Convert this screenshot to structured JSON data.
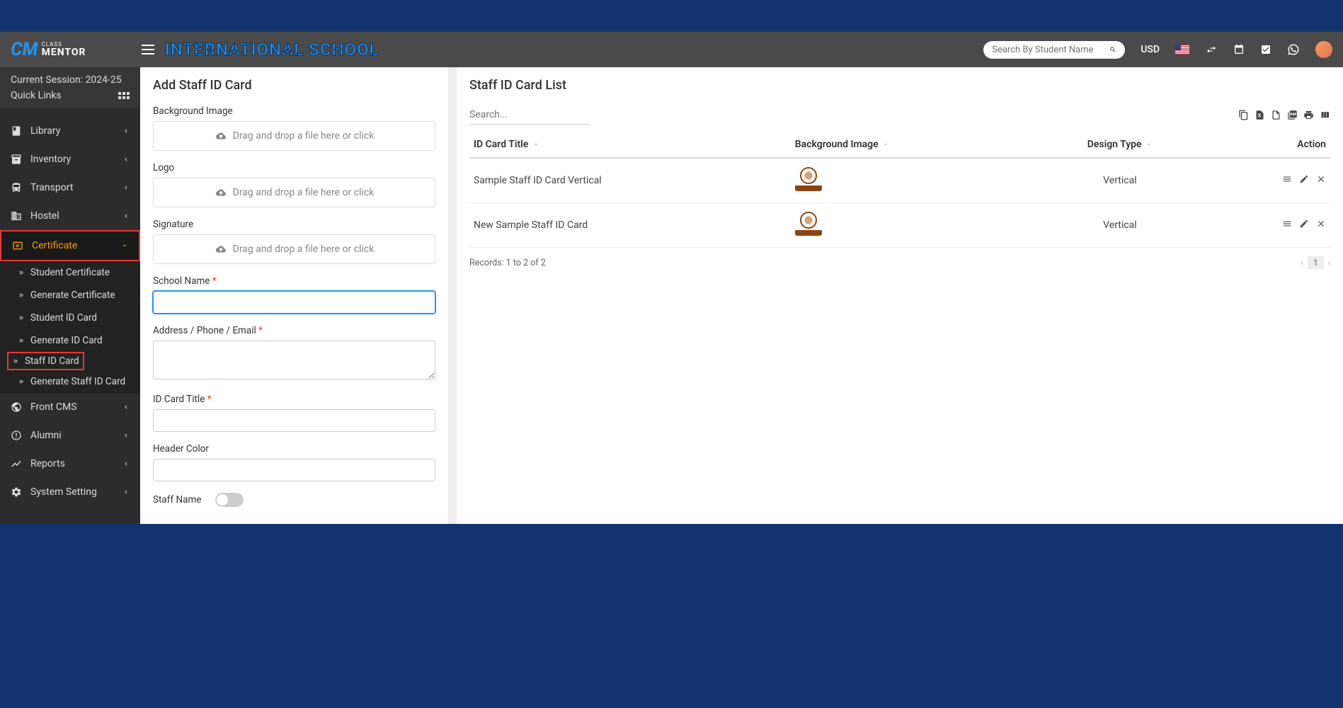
{
  "header": {
    "school_title": "INTERNATIONAL SCHOOL",
    "search_placeholder": "Search By Student Name",
    "currency": "USD"
  },
  "sidebar": {
    "session_text": "Current Session: 2024-25",
    "quick_links": "Quick Links",
    "items": [
      {
        "label": "Library",
        "icon": "book"
      },
      {
        "label": "Inventory",
        "icon": "inventory"
      },
      {
        "label": "Transport",
        "icon": "bus"
      },
      {
        "label": "Hostel",
        "icon": "building"
      },
      {
        "label": "Certificate",
        "icon": "certificate",
        "highlighted": true,
        "expanded": true
      },
      {
        "label": "Front CMS",
        "icon": "gear-box"
      },
      {
        "label": "Alumni",
        "icon": "globe"
      },
      {
        "label": "Reports",
        "icon": "chart"
      },
      {
        "label": "System Setting",
        "icon": "cogs"
      }
    ],
    "cert_subitems": [
      {
        "label": "Student Certificate"
      },
      {
        "label": "Generate Certificate"
      },
      {
        "label": "Student ID Card"
      },
      {
        "label": "Generate ID Card"
      },
      {
        "label": "Staff ID Card",
        "active": true
      },
      {
        "label": "Generate Staff ID Card"
      }
    ]
  },
  "form": {
    "title": "Add Staff ID Card",
    "bg_image_label": "Background Image",
    "logo_label": "Logo",
    "signature_label": "Signature",
    "dropzone_text": "Drag and drop a file here or click",
    "school_name_label": "School Name",
    "address_label": "Address / Phone / Email",
    "id_title_label": "ID Card Title",
    "header_color_label": "Header Color",
    "staff_name_label": "Staff Name"
  },
  "list": {
    "title": "Staff ID Card List",
    "search_placeholder": "Search...",
    "columns": {
      "title": "ID Card Title",
      "bg": "Background Image",
      "design": "Design Type",
      "action": "Action"
    },
    "rows": [
      {
        "title": "Sample Staff ID Card Vertical",
        "design": "Vertical"
      },
      {
        "title": "New Sample Staff ID Card",
        "design": "Vertical"
      }
    ],
    "records_text": "Records: 1 to 2 of 2",
    "page": "1"
  }
}
